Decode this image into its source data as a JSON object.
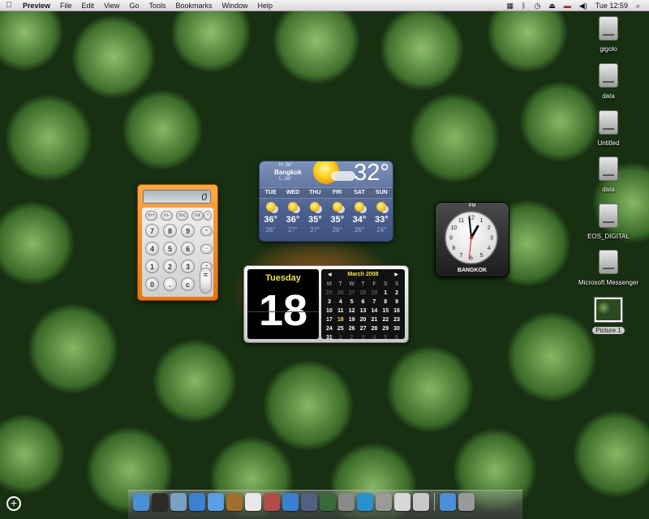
{
  "menubar": {
    "app_name": "Preview",
    "items": [
      "File",
      "Edit",
      "View",
      "Go",
      "Tools",
      "Bookmarks",
      "Window",
      "Help"
    ],
    "clock": "Tue 12:59"
  },
  "desktop_icons": [
    {
      "label": "gigolo",
      "type": "drive"
    },
    {
      "label": "data",
      "type": "drive"
    },
    {
      "label": "Untitled",
      "type": "drive"
    },
    {
      "label": "data",
      "type": "drive"
    },
    {
      "label": "EOS_DIGITAL",
      "type": "drive"
    },
    {
      "label": "Microsoft Messenger",
      "type": "drive"
    },
    {
      "label": "Picture 1",
      "type": "image",
      "selected": true
    }
  ],
  "weather": {
    "city": "Bangkok",
    "high": "H: 36°",
    "low": "L: 26°",
    "temp": "32°",
    "days": [
      {
        "day": "TUE",
        "high": "36°",
        "low": "26°"
      },
      {
        "day": "WED",
        "high": "36°",
        "low": "27°"
      },
      {
        "day": "THU",
        "high": "35°",
        "low": "27°"
      },
      {
        "day": "FRI",
        "high": "35°",
        "low": "26°"
      },
      {
        "day": "SAT",
        "high": "34°",
        "low": "26°"
      },
      {
        "day": "SUN",
        "high": "33°",
        "low": "24°"
      }
    ]
  },
  "calculator": {
    "display": "0",
    "keys": [
      "m+",
      "m-",
      "mc",
      "mr",
      "÷",
      "7",
      "8",
      "9",
      "×",
      "4",
      "5",
      "6",
      "−",
      "1",
      "2",
      "3",
      "+",
      "0",
      ".",
      "c",
      "="
    ]
  },
  "clock_widget": {
    "ampm": "PM",
    "city": "BANGKOK",
    "hour": 12,
    "minute": 59,
    "second": 31
  },
  "date_widget": {
    "weekday": "Tuesday",
    "day": "18",
    "month_label": "March 2008",
    "prev": "◀",
    "next": "▶",
    "weekday_headers": [
      "M",
      "T",
      "W",
      "T",
      "F",
      "S",
      "S"
    ],
    "cells": [
      {
        "d": "25",
        "dim": true
      },
      {
        "d": "26",
        "dim": true
      },
      {
        "d": "27",
        "dim": true
      },
      {
        "d": "28",
        "dim": true
      },
      {
        "d": "29",
        "dim": true
      },
      {
        "d": "1"
      },
      {
        "d": "2"
      },
      {
        "d": "3"
      },
      {
        "d": "4"
      },
      {
        "d": "5"
      },
      {
        "d": "6"
      },
      {
        "d": "7"
      },
      {
        "d": "8"
      },
      {
        "d": "9"
      },
      {
        "d": "10"
      },
      {
        "d": "11"
      },
      {
        "d": "12"
      },
      {
        "d": "13"
      },
      {
        "d": "14"
      },
      {
        "d": "15"
      },
      {
        "d": "16"
      },
      {
        "d": "17"
      },
      {
        "d": "18",
        "today": true
      },
      {
        "d": "19"
      },
      {
        "d": "20"
      },
      {
        "d": "21"
      },
      {
        "d": "22"
      },
      {
        "d": "23"
      },
      {
        "d": "24"
      },
      {
        "d": "25"
      },
      {
        "d": "26"
      },
      {
        "d": "27"
      },
      {
        "d": "28"
      },
      {
        "d": "29"
      },
      {
        "d": "30"
      },
      {
        "d": "31"
      },
      {
        "d": "1",
        "dim": true
      },
      {
        "d": "2",
        "dim": true
      },
      {
        "d": "3",
        "dim": true
      },
      {
        "d": "4",
        "dim": true
      },
      {
        "d": "5",
        "dim": true
      },
      {
        "d": "6",
        "dim": true
      }
    ]
  },
  "dock": {
    "items": [
      {
        "name": "finder-icon",
        "color": "#4a8fd8"
      },
      {
        "name": "dashboard-icon",
        "color": "#2b2b2b"
      },
      {
        "name": "mail-icon",
        "color": "#7aa0c8"
      },
      {
        "name": "safari-icon",
        "color": "#3d7fd0"
      },
      {
        "name": "ichat-icon",
        "color": "#5aa0e0"
      },
      {
        "name": "address-book-icon",
        "color": "#a0702c"
      },
      {
        "name": "ical-icon",
        "color": "#e8e8e8"
      },
      {
        "name": "iphoto-icon",
        "color": "#b44a4a"
      },
      {
        "name": "itunes-icon",
        "color": "#3a7fd0"
      },
      {
        "name": "spaces-icon",
        "color": "#506080"
      },
      {
        "name": "time-machine-icon",
        "color": "#3a6a3a"
      },
      {
        "name": "system-preferences-icon",
        "color": "#8a8a8a"
      },
      {
        "name": "messenger-icon",
        "color": "#2a8fd0"
      },
      {
        "name": "preview-icon",
        "color": "#9a9a9a"
      },
      {
        "name": "textedit-icon",
        "color": "#d8d8d8"
      },
      {
        "name": "documents-stack-icon",
        "color": "#c8c8c8"
      },
      {
        "name": "downloads-stack-icon",
        "color": "#4a8fd8"
      },
      {
        "name": "trash-icon",
        "color": "#9a9a9a"
      }
    ]
  }
}
